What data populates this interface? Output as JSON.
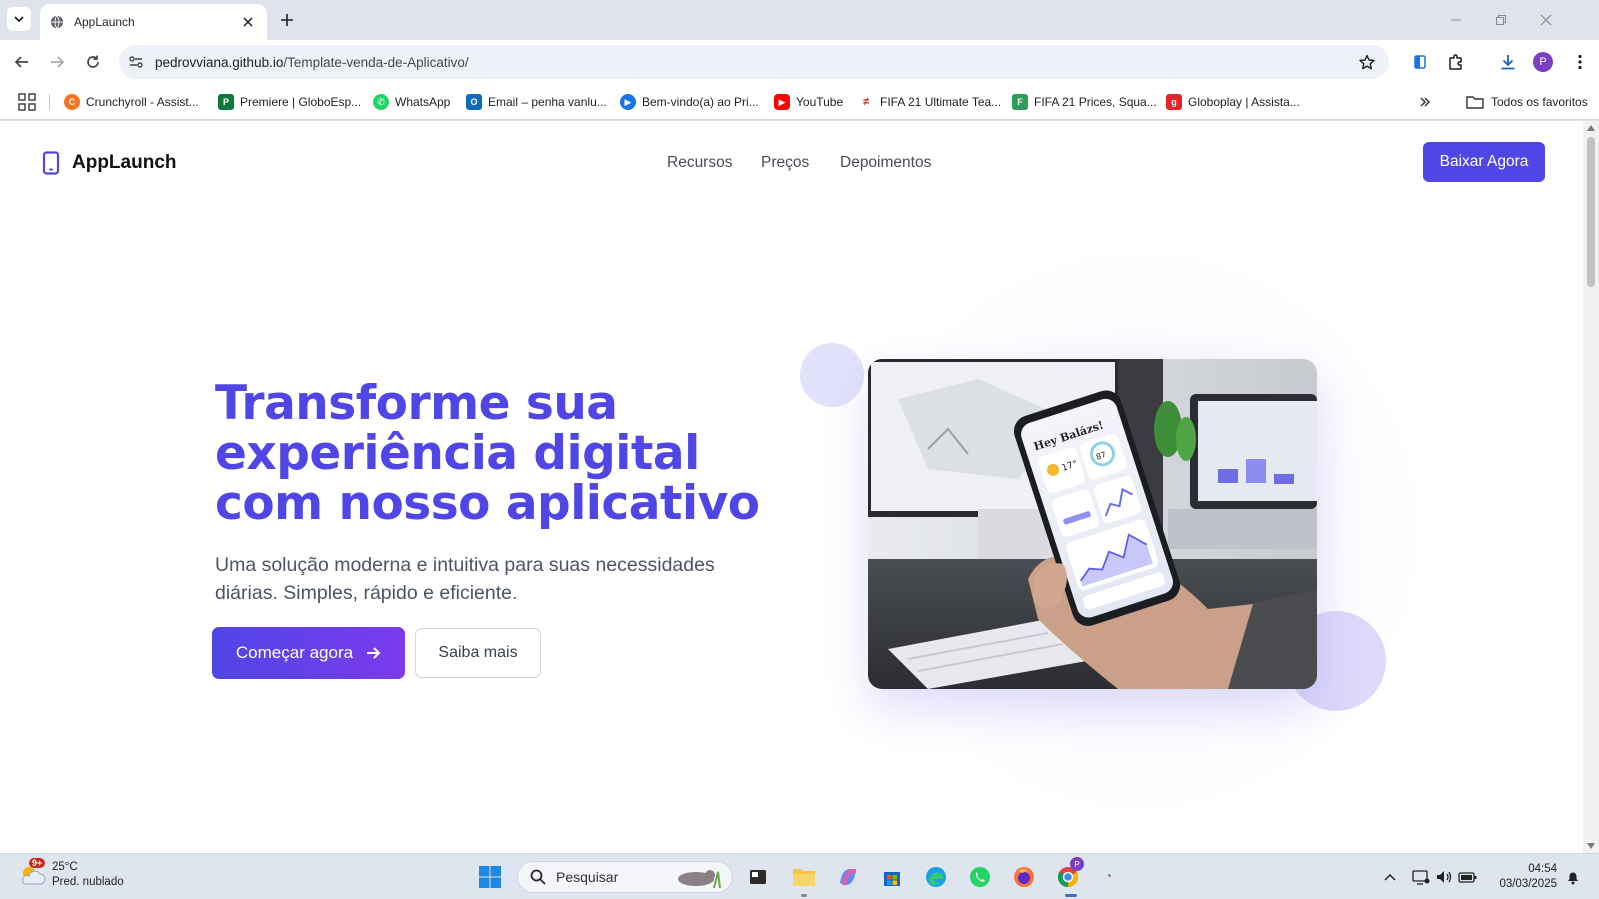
{
  "browser": {
    "tab": {
      "title": "AppLaunch"
    },
    "address": {
      "host": "pedrovviana.github.io",
      "path": "/Template-venda-de-Aplicativo/"
    },
    "profile_initial": "P",
    "bookmarks": [
      {
        "label": "Crunchyroll - Assist...",
        "color": "#f47521",
        "icon": "crunchyroll-icon"
      },
      {
        "label": "Premiere | GloboEsp...",
        "color": "#0a7a3a",
        "icon": "premiere-icon"
      },
      {
        "label": "WhatsApp",
        "color": "#25d366",
        "icon": "whatsapp-icon"
      },
      {
        "label": "Email – penha vanlu...",
        "color": "#0f6cbd",
        "icon": "outlook-icon"
      },
      {
        "label": "Bem-vindo(a) ao Pri...",
        "color": "#1a73e8",
        "icon": "prime-icon"
      },
      {
        "label": "YouTube",
        "color": "#ff0000",
        "icon": "youtube-icon"
      },
      {
        "label": "FIFA 21 Ultimate Tea...",
        "color": "#d32f2f",
        "icon": "futhead-icon"
      },
      {
        "label": "FIFA 21 Prices, Squa...",
        "color": "#2e9d57",
        "icon": "futbin-icon"
      },
      {
        "label": "Globoplay | Assista...",
        "color": "#e5242b",
        "icon": "globoplay-icon"
      }
    ],
    "all_bookmarks_label": "Todos os favoritos"
  },
  "site": {
    "brand": "AppLaunch",
    "nav": [
      "Recursos",
      "Preços",
      "Depoimentos"
    ],
    "cta": "Baixar Agora",
    "hero": {
      "title_line1": "Transforme sua",
      "title_line2": "experiência digital",
      "title_line3": "com nosso aplicativo",
      "subtitle": "Uma solução moderna e intuitiva para suas necessidades diárias. Simples, rápido e eficiente.",
      "primary_button": "Começar agora",
      "secondary_button": "Saiba mais"
    },
    "phone_screen": {
      "greeting": "Hey Balázs!",
      "temp": "17°",
      "stat": "87"
    },
    "accent_color": "#4f46e5"
  },
  "taskbar": {
    "weather": {
      "temp": "25°C",
      "desc": "Pred. nublado",
      "badge": "9+"
    },
    "search_placeholder": "Pesquisar",
    "time": "04:54",
    "date": "03/03/2025"
  }
}
